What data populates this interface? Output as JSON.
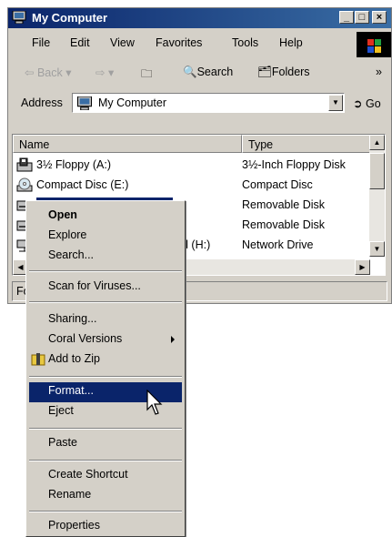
{
  "window": {
    "title": "My Computer",
    "controls": {
      "minimize": "_",
      "maximize": "□",
      "close": "×"
    }
  },
  "menubar": [
    "File",
    "Edit",
    "View",
    "Favorites",
    "Tools",
    "Help"
  ],
  "toolbar": {
    "back": "Back",
    "search": "Search",
    "folders": "Folders",
    "more": "»"
  },
  "address": {
    "label": "Address",
    "value": "My Computer",
    "go": "Go"
  },
  "list": {
    "columns": [
      "Name",
      "Type"
    ],
    "rows": [
      {
        "name": "3½ Floppy (A:)",
        "type": "3½-Inch Floppy Disk",
        "icon": "floppy-icon"
      },
      {
        "name": "Compact Disc (E:)",
        "type": "Compact Disc",
        "icon": "cd-icon"
      },
      {
        "name": "",
        "type": "Removable Disk",
        "icon": "removable-disk-icon",
        "selected": true
      },
      {
        "name": "",
        "type": "Removable Disk",
        "icon": "removable-disk-icon"
      },
      {
        "name": "d (H:)",
        "type": "Network Drive",
        "icon": "network-drive-icon"
      }
    ]
  },
  "status": {
    "text": "Fo"
  },
  "context_menu": {
    "items": [
      {
        "label": "Open",
        "bold": true
      },
      {
        "label": "Explore"
      },
      {
        "label": "Search..."
      },
      {
        "sep": true
      },
      {
        "label": "Scan for Viruses..."
      },
      {
        "sep": true
      },
      {
        "label": "Sharing..."
      },
      {
        "label": "Coral Versions",
        "submenu": true
      },
      {
        "label": "Add to Zip",
        "icon": "zip-icon"
      },
      {
        "sep": true
      },
      {
        "label": "Format...",
        "highlighted": true
      },
      {
        "label": "Eject"
      },
      {
        "sep": true
      },
      {
        "label": "Paste"
      },
      {
        "sep": true
      },
      {
        "label": "Create Shortcut"
      },
      {
        "label": "Rename"
      },
      {
        "sep": true
      },
      {
        "label": "Properties"
      }
    ]
  },
  "colors": {
    "titlebar": "#0a246a",
    "highlight": "#0a246a",
    "face": "#d4d0c8"
  }
}
